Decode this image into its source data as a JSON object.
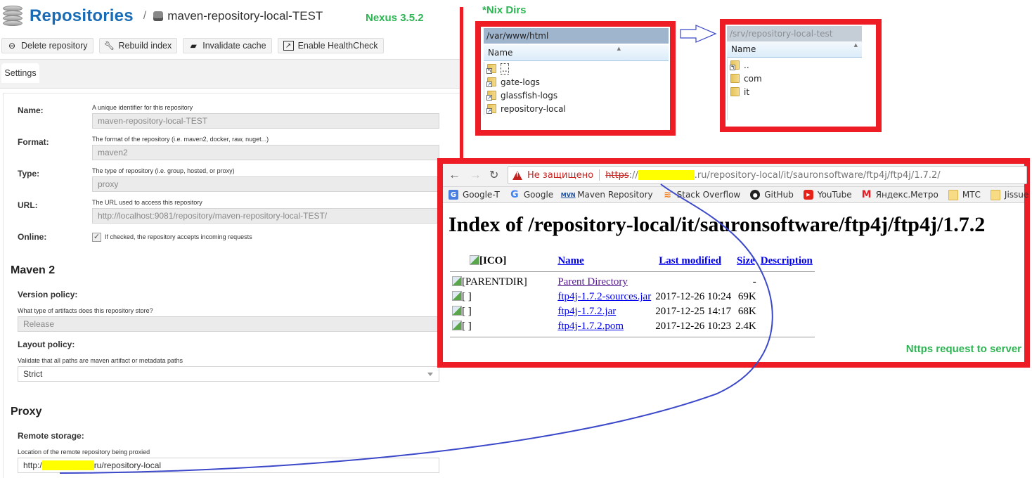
{
  "nexus": {
    "title": "Repositories",
    "breadcrumb_sep": "/",
    "repo_name": "maven-repository-local-TEST",
    "version_label": "Nexus 3.5.2",
    "toolbar": [
      {
        "label": "Delete repository",
        "icon": "minus-circle-icon"
      },
      {
        "label": "Rebuild index",
        "icon": "wrench-icon"
      },
      {
        "label": "Invalidate cache",
        "icon": "eraser-icon"
      },
      {
        "label": "Enable HealthCheck",
        "icon": "chart-line-icon"
      }
    ],
    "tab": "Settings",
    "fields": {
      "name": {
        "label": "Name:",
        "help": "A unique identifier for this repository",
        "value": "maven-repository-local-TEST"
      },
      "format": {
        "label": "Format:",
        "help": "The format of the repository (i.e. maven2, docker, raw, nuget...)",
        "value": "maven2"
      },
      "type": {
        "label": "Type:",
        "help": "The type of repository (i.e. group, hosted, or proxy)",
        "value": "proxy"
      },
      "url": {
        "label": "URL:",
        "help": "The URL used to access this repository",
        "value": "http://localhost:9081/repository/maven-repository-local-TEST/"
      },
      "online": {
        "label": "Online:",
        "checked": true,
        "help": "If checked, the repository accepts incoming requests"
      }
    },
    "maven2": {
      "section_title": "Maven 2",
      "version_policy": {
        "label": "Version policy:",
        "help": "What type of artifacts does this repository store?",
        "value": "Release"
      },
      "layout_policy": {
        "label": "Layout policy:",
        "help": "Validate that all paths are maven artifact or metadata paths",
        "value": "Strict"
      }
    },
    "proxy": {
      "section_title": "Proxy",
      "remote_storage": {
        "label": "Remote storage:",
        "help": "Location of the remote repository being proxied",
        "value_prefix": "http:/",
        "value_suffix": "ru/repository-local"
      }
    }
  },
  "annotations": {
    "nix_dirs": "*Nix Dirs",
    "https_note": "Nttps request to server",
    "annotation_color": "#ee1c25",
    "note_color": "#2db553",
    "curve_color": "#3b48c9"
  },
  "explorer_left": {
    "path": "/var/www/html",
    "column": "Name",
    "items": [
      {
        "name": "..",
        "type": "up"
      },
      {
        "name": "gate-logs",
        "type": "link"
      },
      {
        "name": "glassfish-logs",
        "type": "link"
      },
      {
        "name": "repository-local",
        "type": "link"
      }
    ]
  },
  "explorer_right": {
    "path": "/srv/repository-local-test",
    "column": "Name",
    "items": [
      {
        "name": "..",
        "type": "up"
      },
      {
        "name": "com",
        "type": "folder"
      },
      {
        "name": "it",
        "type": "folder"
      }
    ]
  },
  "browser": {
    "security_label": "Не защищено",
    "url_scheme": "https",
    "url_after_scheme": "://",
    "url_after_host": ".ru/repository-local/it/sauronsoftware/ftp4j/ftp4j/1.7.2/",
    "bookmarks": [
      {
        "label": "Google-T",
        "icon": "google-translate-icon"
      },
      {
        "label": "Google",
        "icon": "google-icon"
      },
      {
        "label": "Maven Repository",
        "icon": "mvn-icon"
      },
      {
        "label": "Stack Overflow",
        "icon": "stackoverflow-icon"
      },
      {
        "label": "GitHub",
        "icon": "github-icon"
      },
      {
        "label": "YouTube",
        "icon": "youtube-icon"
      },
      {
        "label": "Яндекс.Метро",
        "icon": "yandex-metro-icon"
      },
      {
        "label": "МТС",
        "icon": "folder-icon"
      },
      {
        "label": "Jissue",
        "icon": "folder-icon"
      }
    ],
    "page": {
      "title": "Index of /repository-local/it/sauronsoftware/ftp4j/ftp4j/1.7.2",
      "headers": [
        "[ICO]",
        "Name",
        "Last modified",
        "Size",
        "Description"
      ],
      "rows": [
        {
          "icon_alt": "[PARENTDIR]",
          "name": "Parent Directory",
          "modified": "",
          "size": "-",
          "visited": true
        },
        {
          "icon_alt": "[ ]",
          "name": "ftp4j-1.7.2-sources.jar",
          "modified": "2017-12-26 10:24",
          "size": "69K",
          "visited": false
        },
        {
          "icon_alt": "[ ]",
          "name": "ftp4j-1.7.2.jar",
          "modified": "2017-12-25 14:17",
          "size": "68K",
          "visited": false
        },
        {
          "icon_alt": "[ ]",
          "name": "ftp4j-1.7.2.pom",
          "modified": "2017-12-26 10:23",
          "size": "2.4K",
          "visited": false
        }
      ]
    }
  }
}
